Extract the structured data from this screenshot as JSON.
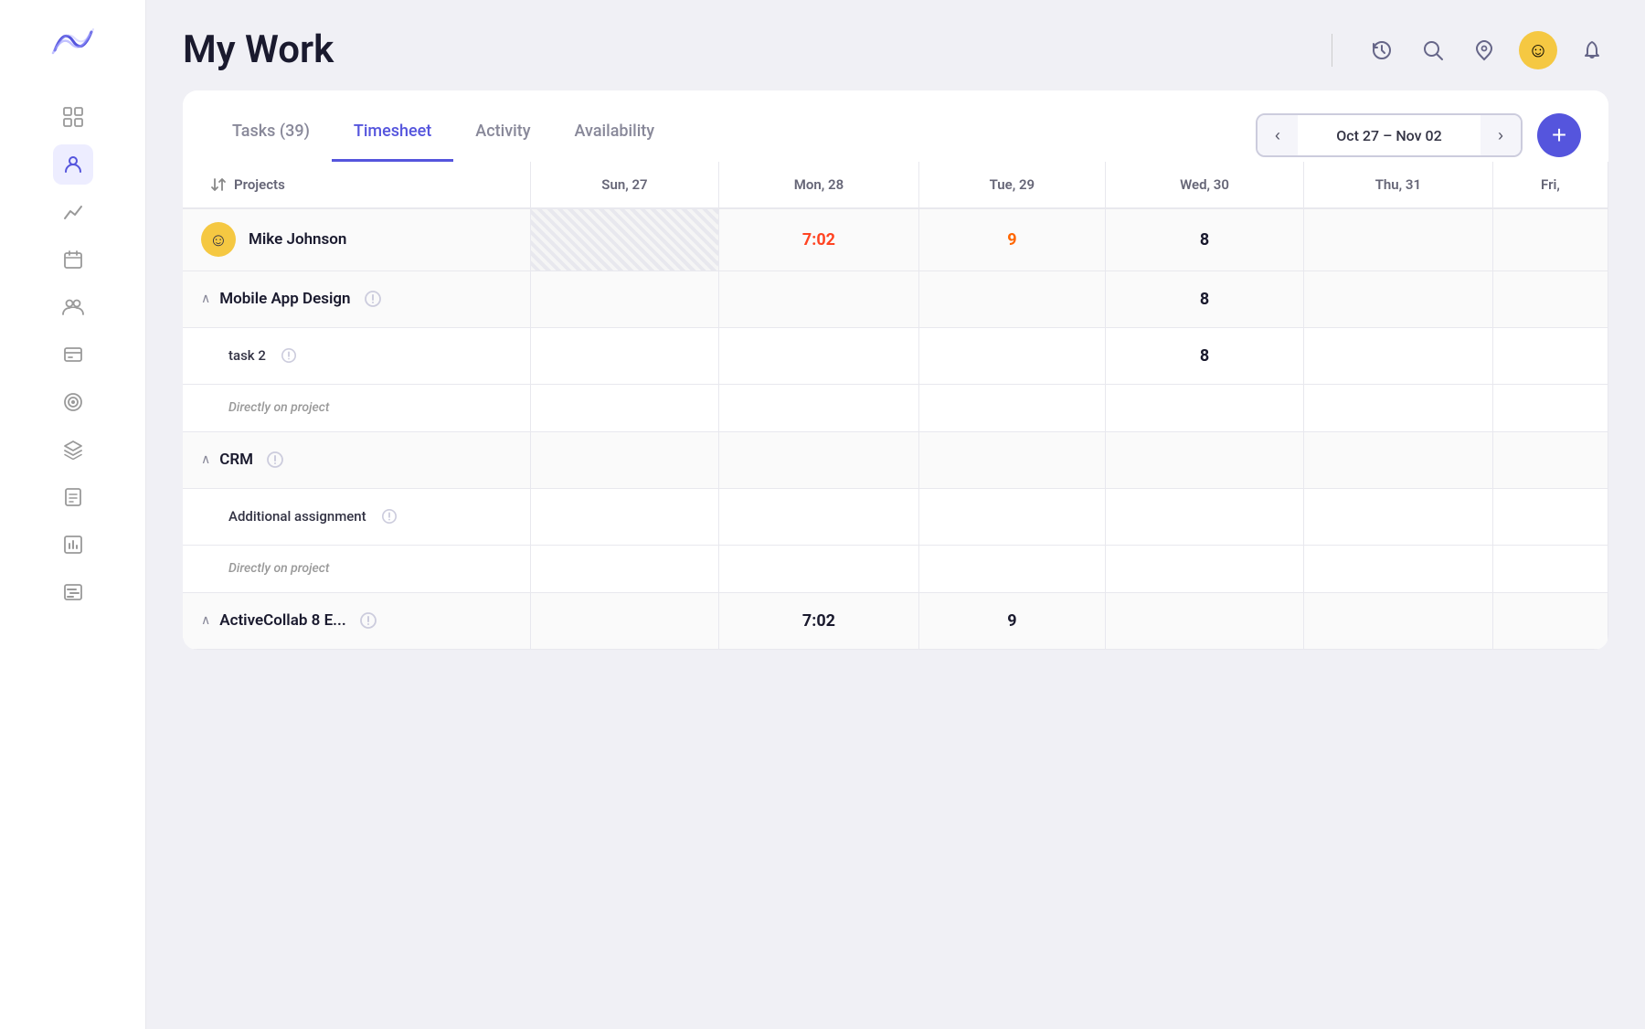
{
  "page": {
    "title": "My Work"
  },
  "header": {
    "icons": {
      "history": "⏱",
      "search": "🔍",
      "rocket": "🚀",
      "bell": "🔔"
    },
    "avatar": "☺"
  },
  "sidebar": {
    "items": [
      {
        "id": "grid",
        "icon": "⊞",
        "active": false
      },
      {
        "id": "person",
        "icon": "👤",
        "active": true
      },
      {
        "id": "chart",
        "icon": "📈",
        "active": false
      },
      {
        "id": "calendar",
        "icon": "📅",
        "active": false
      },
      {
        "id": "group",
        "icon": "👥",
        "active": false
      },
      {
        "id": "billing",
        "icon": "💲",
        "active": false
      },
      {
        "id": "target",
        "icon": "🎯",
        "active": false
      },
      {
        "id": "layers",
        "icon": "◫",
        "active": false
      },
      {
        "id": "tasks",
        "icon": "📋",
        "active": false
      },
      {
        "id": "report",
        "icon": "📊",
        "active": false
      },
      {
        "id": "gantt",
        "icon": "📉",
        "active": false
      }
    ]
  },
  "tabs": [
    {
      "id": "tasks",
      "label": "Tasks (39)",
      "active": false
    },
    {
      "id": "timesheet",
      "label": "Timesheet",
      "active": true
    },
    {
      "id": "activity",
      "label": "Activity",
      "active": false
    },
    {
      "id": "availability",
      "label": "Availability",
      "active": false
    }
  ],
  "dateRange": {
    "display": "Oct 27 – Nov 02",
    "prev": "‹",
    "next": "›"
  },
  "addButton": "+",
  "grid": {
    "columns": [
      {
        "id": "projects",
        "label": "Projects"
      },
      {
        "id": "sun27",
        "label": "Sun, 27"
      },
      {
        "id": "mon28",
        "label": "Mon, 28"
      },
      {
        "id": "tue29",
        "label": "Tue, 29"
      },
      {
        "id": "wed30",
        "label": "Wed, 30"
      },
      {
        "id": "thu31",
        "label": "Thu, 31"
      },
      {
        "id": "fri",
        "label": "Fri,"
      }
    ],
    "rows": [
      {
        "type": "user",
        "name": "Mike Johnson",
        "values": {
          "sun": "",
          "mon": "7:02",
          "monType": "red",
          "tue": "9",
          "tueType": "orange",
          "wed": "8",
          "wedType": "dark",
          "thu": "",
          "fri": ""
        }
      },
      {
        "type": "project",
        "name": "Mobile App Design",
        "expanded": true,
        "values": {
          "sun": "",
          "mon": "",
          "tue": "",
          "wed": "8",
          "wedType": "dark",
          "thu": "",
          "fri": ""
        }
      },
      {
        "type": "task",
        "name": "task 2",
        "values": {
          "sun": "",
          "mon": "",
          "tue": "",
          "wed": "8",
          "wedType": "dark",
          "thu": "",
          "fri": ""
        }
      },
      {
        "type": "direct",
        "name": "Directly on project",
        "values": {
          "sun": "",
          "mon": "",
          "tue": "",
          "wed": "",
          "thu": "",
          "fri": ""
        }
      },
      {
        "type": "project",
        "name": "CRM",
        "expanded": true,
        "values": {
          "sun": "",
          "mon": "",
          "tue": "",
          "wed": "",
          "thu": "",
          "fri": ""
        }
      },
      {
        "type": "task",
        "name": "Additional assignment",
        "values": {
          "sun": "",
          "mon": "",
          "tue": "",
          "wed": "",
          "thu": "",
          "fri": ""
        }
      },
      {
        "type": "direct",
        "name": "Directly on project",
        "values": {
          "sun": "",
          "mon": "",
          "tue": "",
          "wed": "",
          "thu": "",
          "fri": ""
        }
      },
      {
        "type": "project",
        "name": "ActiveCollab 8 E...",
        "expanded": true,
        "values": {
          "sun": "",
          "mon": "7:02",
          "monType": "dark",
          "tue": "9",
          "tueType": "dark",
          "wed": "",
          "thu": "",
          "fri": ""
        }
      }
    ]
  }
}
